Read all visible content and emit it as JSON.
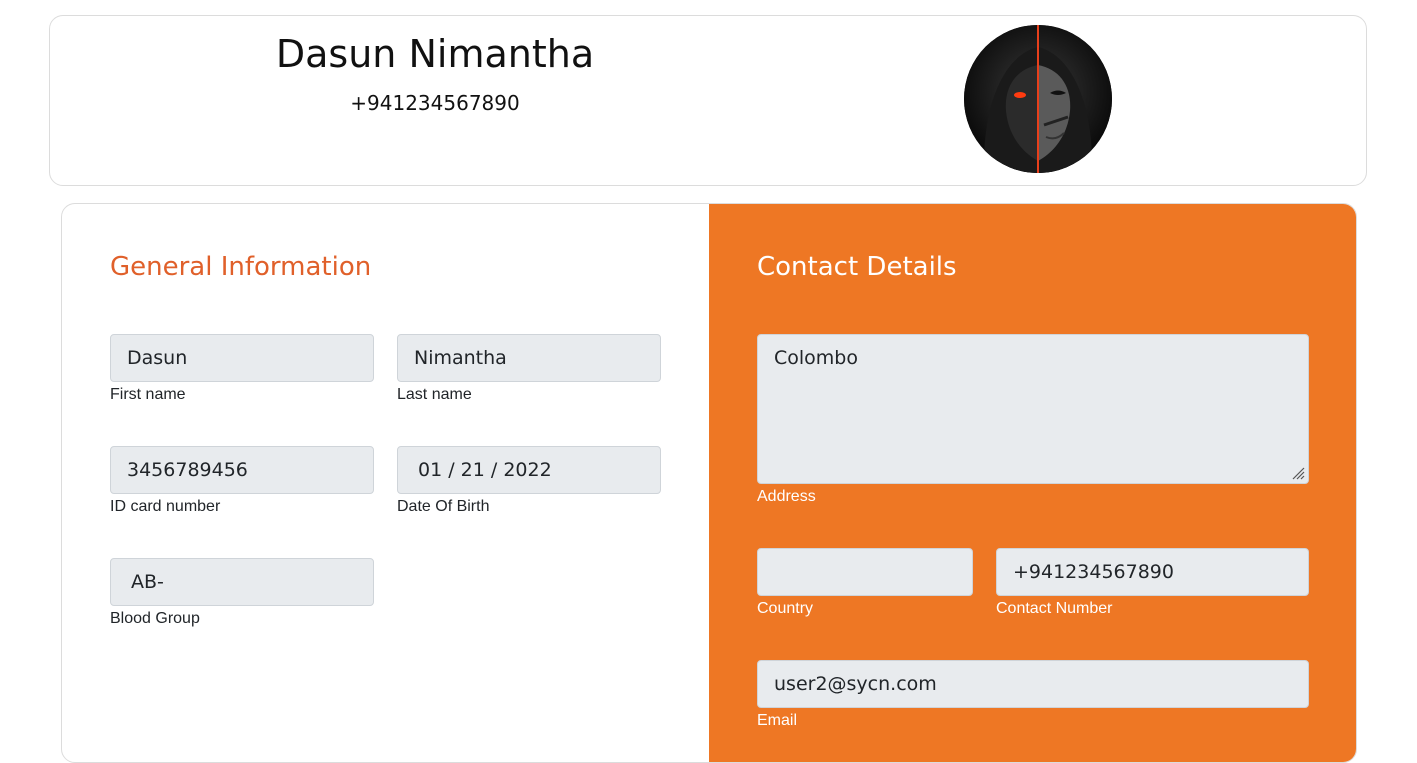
{
  "profile": {
    "name": "Dasun Nimantha",
    "phone": "+941234567890",
    "avatar_icon": "hacker-mask-avatar"
  },
  "general": {
    "title": "General Information",
    "first_name": {
      "value": "Dasun",
      "label": "First name"
    },
    "last_name": {
      "value": "Nimantha",
      "label": "Last name"
    },
    "id_card": {
      "value": "3456789456",
      "label": "ID card number"
    },
    "dob": {
      "value": "01 / 21 / 2022",
      "label": "Date Of Birth"
    },
    "blood_group": {
      "value": "AB-",
      "label": "Blood Group"
    }
  },
  "contact": {
    "title": "Contact Details",
    "address": {
      "value": "Colombo",
      "label": "Address"
    },
    "country": {
      "value": "",
      "label": "Country"
    },
    "contact_number": {
      "value": "+941234567890",
      "label": "Contact Number"
    },
    "email": {
      "value": "user2@sycn.com",
      "label": "Email"
    }
  },
  "colors": {
    "accent": "#ee7724",
    "title_accent": "#e0602a",
    "input_bg": "#e8ebee"
  }
}
